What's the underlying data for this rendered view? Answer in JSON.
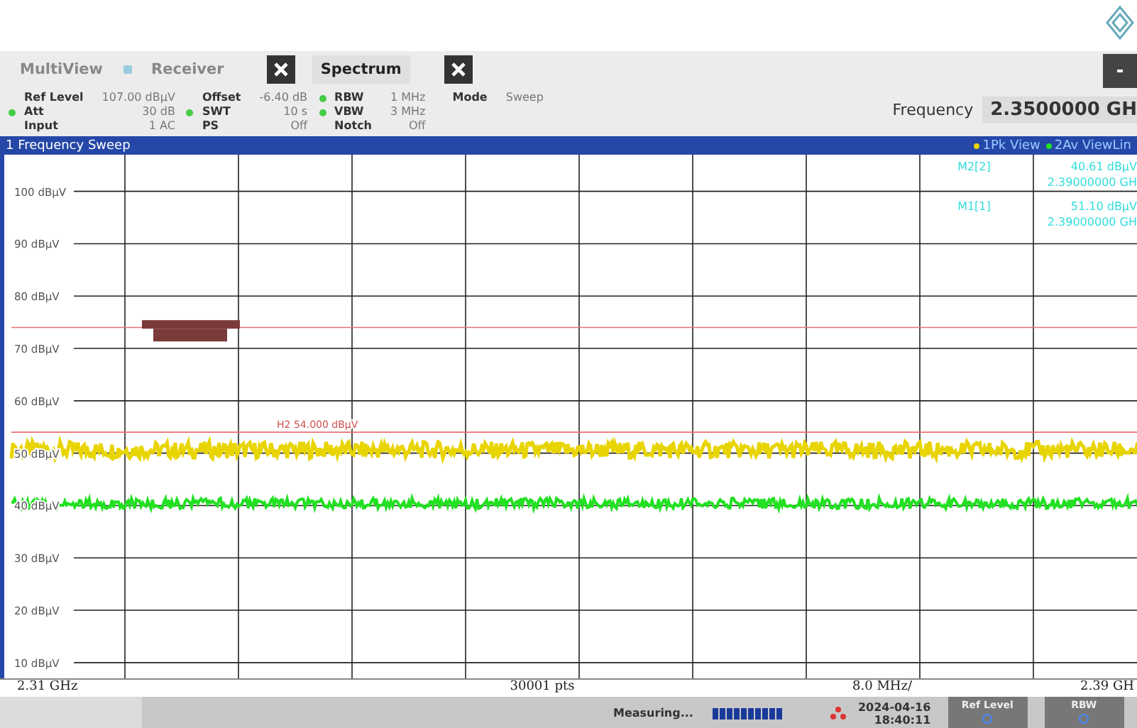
{
  "tabs": [
    {
      "label": "MultiView",
      "selected": false,
      "closable": false
    },
    {
      "label": "Receiver",
      "selected": false,
      "closable": true
    },
    {
      "label": "Spectrum",
      "selected": true,
      "closable": true
    }
  ],
  "settings": [
    [
      {
        "label": "Ref Level",
        "value": "107.00 dBµV",
        "coupled": false
      },
      {
        "label": "Att",
        "value": "30 dB",
        "coupled": true
      },
      {
        "label": "Input",
        "value": "1 AC",
        "coupled": false
      }
    ],
    [
      {
        "label": "Offset",
        "value": "-6.40 dB",
        "coupled": false
      },
      {
        "label": "SWT",
        "value": "10 s",
        "coupled": true
      },
      {
        "label": "PS",
        "value": "Off",
        "coupled": false
      }
    ],
    [
      {
        "label": "RBW",
        "value": "1 MHz",
        "coupled": true
      },
      {
        "label": "VBW",
        "value": "3 MHz",
        "coupled": true
      },
      {
        "label": "Notch",
        "value": "Off",
        "coupled": false
      }
    ],
    [
      {
        "label": "Mode",
        "value": "Sweep",
        "coupled": false
      }
    ]
  ],
  "frequency": {
    "label": "Frequency",
    "value": "2.3500000 GH"
  },
  "plot": {
    "title": "1 Frequency Sweep",
    "markers": [
      {
        "name": "M2[2]",
        "value": "40.61 dBµV",
        "position": "2.39000000 GH"
      },
      {
        "name": "M1[1]",
        "value": "51.10 dBµV",
        "position": "2.39000000 GH"
      }
    ],
    "y_labels": [
      "100 dBµV",
      "90 dBµV",
      "80 dBµV",
      "70 dBµV",
      "60 dBµV",
      "50 dBµV",
      "40 dBµV",
      "30 dBµV",
      "20 dBµV",
      "10 dBµV"
    ],
    "traces": [
      {
        "name": "1Pk View",
        "color": "#e8d400"
      },
      {
        "name": "2Av ViewLin",
        "color": "#22e022"
      }
    ],
    "limit_label": "H2 54.000 dBµV",
    "footer": {
      "start": "2.31 GHz",
      "points": "30001 pts",
      "span": "8.0 MHz/",
      "stop": "2.39 GH"
    }
  },
  "status": {
    "message": "Measuring...",
    "date": "2024-04-16",
    "time": "18:40:11",
    "buttons": [
      "Ref Level",
      "RBW"
    ]
  }
}
